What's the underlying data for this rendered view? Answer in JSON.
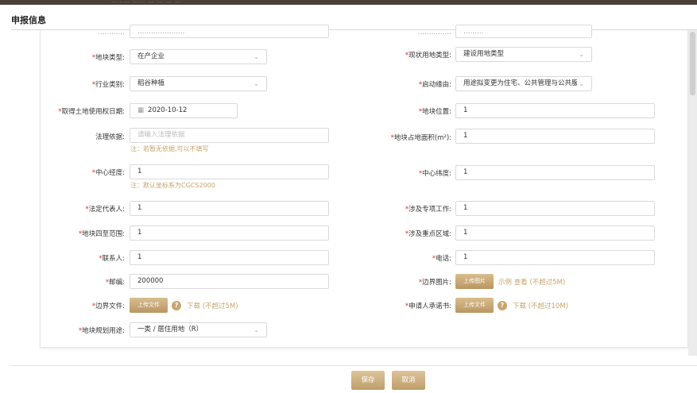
{
  "dialog": {
    "title": "申报信息"
  },
  "top_strip": {
    "text": "……… ……  … … … …"
  },
  "form": {
    "partial_row": {
      "left_label": "…………",
      "left_value": "…………………",
      "right_label": "……………",
      "right_value": "………"
    },
    "land_type": {
      "label": "地块类型:",
      "value": "在产企业"
    },
    "current_use_type": {
      "label": "现状用地类型:",
      "value": "建设用地类型"
    },
    "industry": {
      "label": "行业类别:",
      "value": "稻谷种植"
    },
    "trigger_reason": {
      "label": "启动缘由:",
      "value": "用途拟变更为住宅、公共管理与公共服"
    },
    "acquire_date": {
      "label": "取得土地使用权日期:",
      "value": "2020-10-12"
    },
    "location": {
      "label": "地块位置:",
      "value": "1"
    },
    "legal_basis": {
      "label": "法理依据:",
      "placeholder": "请输入法理依据",
      "note": "注：若暂无依据,可以不填写"
    },
    "land_area": {
      "label": "地块占地面积(m²):",
      "value": "1"
    },
    "center_longitude": {
      "label": "中心经度:",
      "value": "1",
      "note": "注：默认坐标系为CGCS2000"
    },
    "center_latitude": {
      "label": "中心纬度:",
      "value": "1"
    },
    "legal_rep": {
      "label": "法定代表人:",
      "value": "1"
    },
    "special_work": {
      "label": "涉及专项工作:",
      "value": "1"
    },
    "boundary_range": {
      "label": "地块四至范围:",
      "value": "1"
    },
    "key_area": {
      "label": "涉及重点区域:",
      "value": "1"
    },
    "contact": {
      "label": "联系人:",
      "value": "1"
    },
    "phone": {
      "label": "电话:",
      "value": "1"
    },
    "postcode": {
      "label": "邮编:",
      "value": "200000"
    },
    "boundary_image": {
      "label": "边界图片:",
      "button": "上传图片",
      "example": "示例",
      "view": "查看",
      "limit": "(不超过5M)"
    },
    "boundary_file": {
      "label": "边界文件:",
      "button": "上传文件",
      "download": "下载",
      "limit": "(不超过5M)"
    },
    "commitment": {
      "label": "申请人承诺书:",
      "button": "上传文件",
      "download": "下载",
      "limit": "(不超过10M)"
    },
    "planning_use": {
      "label": "地块规划用途:",
      "value": "一类 / 居住用地（R）"
    }
  },
  "footer": {
    "save": "保存",
    "cancel": "取消"
  },
  "colors": {
    "accent": "#c4a46b",
    "required": "#e02a2a"
  }
}
